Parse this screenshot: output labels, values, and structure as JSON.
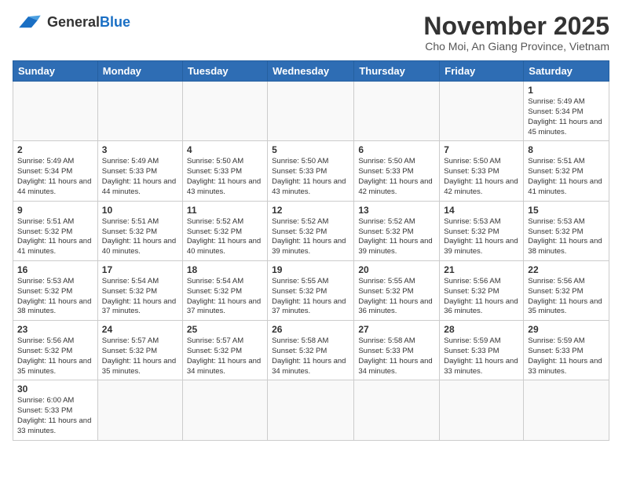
{
  "header": {
    "logo_general": "General",
    "logo_blue": "Blue",
    "month_title": "November 2025",
    "location": "Cho Moi, An Giang Province, Vietnam"
  },
  "days_of_week": [
    "Sunday",
    "Monday",
    "Tuesday",
    "Wednesday",
    "Thursday",
    "Friday",
    "Saturday"
  ],
  "weeks": [
    [
      {
        "day": "",
        "details": ""
      },
      {
        "day": "",
        "details": ""
      },
      {
        "day": "",
        "details": ""
      },
      {
        "day": "",
        "details": ""
      },
      {
        "day": "",
        "details": ""
      },
      {
        "day": "",
        "details": ""
      },
      {
        "day": "1",
        "details": "Sunrise: 5:49 AM\nSunset: 5:34 PM\nDaylight: 11 hours\nand 45 minutes."
      }
    ],
    [
      {
        "day": "2",
        "details": "Sunrise: 5:49 AM\nSunset: 5:34 PM\nDaylight: 11 hours\nand 44 minutes."
      },
      {
        "day": "3",
        "details": "Sunrise: 5:49 AM\nSunset: 5:33 PM\nDaylight: 11 hours\nand 44 minutes."
      },
      {
        "day": "4",
        "details": "Sunrise: 5:50 AM\nSunset: 5:33 PM\nDaylight: 11 hours\nand 43 minutes."
      },
      {
        "day": "5",
        "details": "Sunrise: 5:50 AM\nSunset: 5:33 PM\nDaylight: 11 hours\nand 43 minutes."
      },
      {
        "day": "6",
        "details": "Sunrise: 5:50 AM\nSunset: 5:33 PM\nDaylight: 11 hours\nand 42 minutes."
      },
      {
        "day": "7",
        "details": "Sunrise: 5:50 AM\nSunset: 5:33 PM\nDaylight: 11 hours\nand 42 minutes."
      },
      {
        "day": "8",
        "details": "Sunrise: 5:51 AM\nSunset: 5:32 PM\nDaylight: 11 hours\nand 41 minutes."
      }
    ],
    [
      {
        "day": "9",
        "details": "Sunrise: 5:51 AM\nSunset: 5:32 PM\nDaylight: 11 hours\nand 41 minutes."
      },
      {
        "day": "10",
        "details": "Sunrise: 5:51 AM\nSunset: 5:32 PM\nDaylight: 11 hours\nand 40 minutes."
      },
      {
        "day": "11",
        "details": "Sunrise: 5:52 AM\nSunset: 5:32 PM\nDaylight: 11 hours\nand 40 minutes."
      },
      {
        "day": "12",
        "details": "Sunrise: 5:52 AM\nSunset: 5:32 PM\nDaylight: 11 hours\nand 39 minutes."
      },
      {
        "day": "13",
        "details": "Sunrise: 5:52 AM\nSunset: 5:32 PM\nDaylight: 11 hours\nand 39 minutes."
      },
      {
        "day": "14",
        "details": "Sunrise: 5:53 AM\nSunset: 5:32 PM\nDaylight: 11 hours\nand 39 minutes."
      },
      {
        "day": "15",
        "details": "Sunrise: 5:53 AM\nSunset: 5:32 PM\nDaylight: 11 hours\nand 38 minutes."
      }
    ],
    [
      {
        "day": "16",
        "details": "Sunrise: 5:53 AM\nSunset: 5:32 PM\nDaylight: 11 hours\nand 38 minutes."
      },
      {
        "day": "17",
        "details": "Sunrise: 5:54 AM\nSunset: 5:32 PM\nDaylight: 11 hours\nand 37 minutes."
      },
      {
        "day": "18",
        "details": "Sunrise: 5:54 AM\nSunset: 5:32 PM\nDaylight: 11 hours\nand 37 minutes."
      },
      {
        "day": "19",
        "details": "Sunrise: 5:55 AM\nSunset: 5:32 PM\nDaylight: 11 hours\nand 37 minutes."
      },
      {
        "day": "20",
        "details": "Sunrise: 5:55 AM\nSunset: 5:32 PM\nDaylight: 11 hours\nand 36 minutes."
      },
      {
        "day": "21",
        "details": "Sunrise: 5:56 AM\nSunset: 5:32 PM\nDaylight: 11 hours\nand 36 minutes."
      },
      {
        "day": "22",
        "details": "Sunrise: 5:56 AM\nSunset: 5:32 PM\nDaylight: 11 hours\nand 35 minutes."
      }
    ],
    [
      {
        "day": "23",
        "details": "Sunrise: 5:56 AM\nSunset: 5:32 PM\nDaylight: 11 hours\nand 35 minutes."
      },
      {
        "day": "24",
        "details": "Sunrise: 5:57 AM\nSunset: 5:32 PM\nDaylight: 11 hours\nand 35 minutes."
      },
      {
        "day": "25",
        "details": "Sunrise: 5:57 AM\nSunset: 5:32 PM\nDaylight: 11 hours\nand 34 minutes."
      },
      {
        "day": "26",
        "details": "Sunrise: 5:58 AM\nSunset: 5:32 PM\nDaylight: 11 hours\nand 34 minutes."
      },
      {
        "day": "27",
        "details": "Sunrise: 5:58 AM\nSunset: 5:33 PM\nDaylight: 11 hours\nand 34 minutes."
      },
      {
        "day": "28",
        "details": "Sunrise: 5:59 AM\nSunset: 5:33 PM\nDaylight: 11 hours\nand 33 minutes."
      },
      {
        "day": "29",
        "details": "Sunrise: 5:59 AM\nSunset: 5:33 PM\nDaylight: 11 hours\nand 33 minutes."
      }
    ],
    [
      {
        "day": "30",
        "details": "Sunrise: 6:00 AM\nSunset: 5:33 PM\nDaylight: 11 hours\nand 33 minutes."
      },
      {
        "day": "",
        "details": ""
      },
      {
        "day": "",
        "details": ""
      },
      {
        "day": "",
        "details": ""
      },
      {
        "day": "",
        "details": ""
      },
      {
        "day": "",
        "details": ""
      },
      {
        "day": "",
        "details": ""
      }
    ]
  ]
}
